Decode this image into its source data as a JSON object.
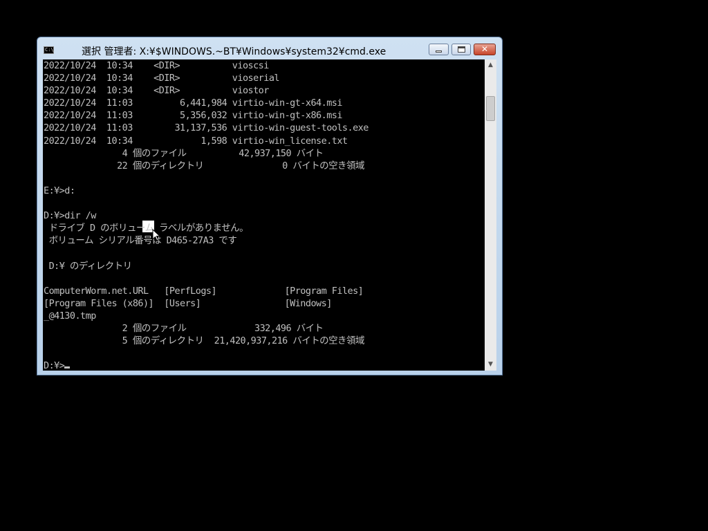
{
  "window": {
    "title": "選択 管理者: X:¥$WINDOWS.~BT¥Windows¥system32¥cmd.exe",
    "icon": "C:\\",
    "close_glyph": "✕"
  },
  "console": {
    "lines": [
      "2022/10/24  10:34    <DIR>          vioscsi",
      "2022/10/24  10:34    <DIR>          vioserial",
      "2022/10/24  10:34    <DIR>          viostor",
      "2022/10/24  11:03         6,441,984 virtio-win-gt-x64.msi",
      "2022/10/24  11:03         5,356,032 virtio-win-gt-x86.msi",
      "2022/10/24  11:03        31,137,536 virtio-win-guest-tools.exe",
      "2022/10/24  10:34             1,598 virtio-win_license.txt",
      "               4 個のファイル          42,937,150 バイト",
      "              22 個のディレクトリ               0 バイトの空き領域",
      "",
      "E:¥>d:",
      "",
      "D:¥>dir /w",
      " ドライブ D のボリューム ラベルがありません。",
      " ボリューム シリアル番号は D465-27A3 です",
      "",
      " D:¥ のディレクトリ",
      "",
      "ComputerWorm.net.URL   [PerfLogs]             [Program Files]",
      "[Program Files (x86)]  [Users]                [Windows]",
      "_@4130.tmp",
      "               2 個のファイル             332,496 バイト",
      "               5 個のディレクトリ  21,420,937,216 バイトの空き領域",
      "",
      "D:¥>"
    ]
  },
  "scrollbar": {
    "up_glyph": "▲",
    "down_glyph": "▼"
  }
}
